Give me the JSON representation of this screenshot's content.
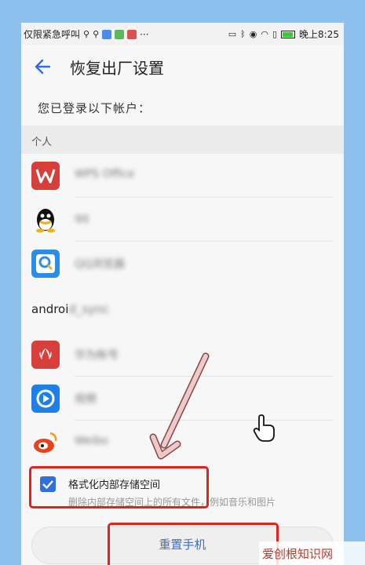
{
  "status_bar": {
    "left_text": "仅限紧急呼叫",
    "time": "晚上8:25",
    "more": "···"
  },
  "app_bar": {
    "title": "恢复出厂设置"
  },
  "subtitle": "您已登录以下帐户：",
  "section_personal": "个人",
  "accounts": [
    {
      "name": "WPS Office",
      "icon": "wps-icon",
      "color": "#d7403a"
    },
    {
      "name": "qq",
      "icon": "qq-icon",
      "color": "#1a1a1a"
    },
    {
      "name": "QQ浏览器",
      "icon": "search-app-icon",
      "color": "#2a8ee8"
    }
  ],
  "group_android": {
    "prefix": "androi",
    "suffix": "d_sync"
  },
  "accounts_android": [
    {
      "name": "华为帐号",
      "icon": "huawei-icon",
      "color": "#d7403a"
    },
    {
      "name": "视频",
      "icon": "video-icon",
      "color": "#1e80e6"
    },
    {
      "name": "Weibo",
      "icon": "weibo-icon",
      "color": "#e8441c"
    }
  ],
  "format_option": {
    "label": "格式化内部存储空间",
    "description": "删除内部存储空间上的所有文件，例如音乐和图片",
    "checked": true
  },
  "reset_button": "重置手机",
  "watermark": "爱创根知识网"
}
